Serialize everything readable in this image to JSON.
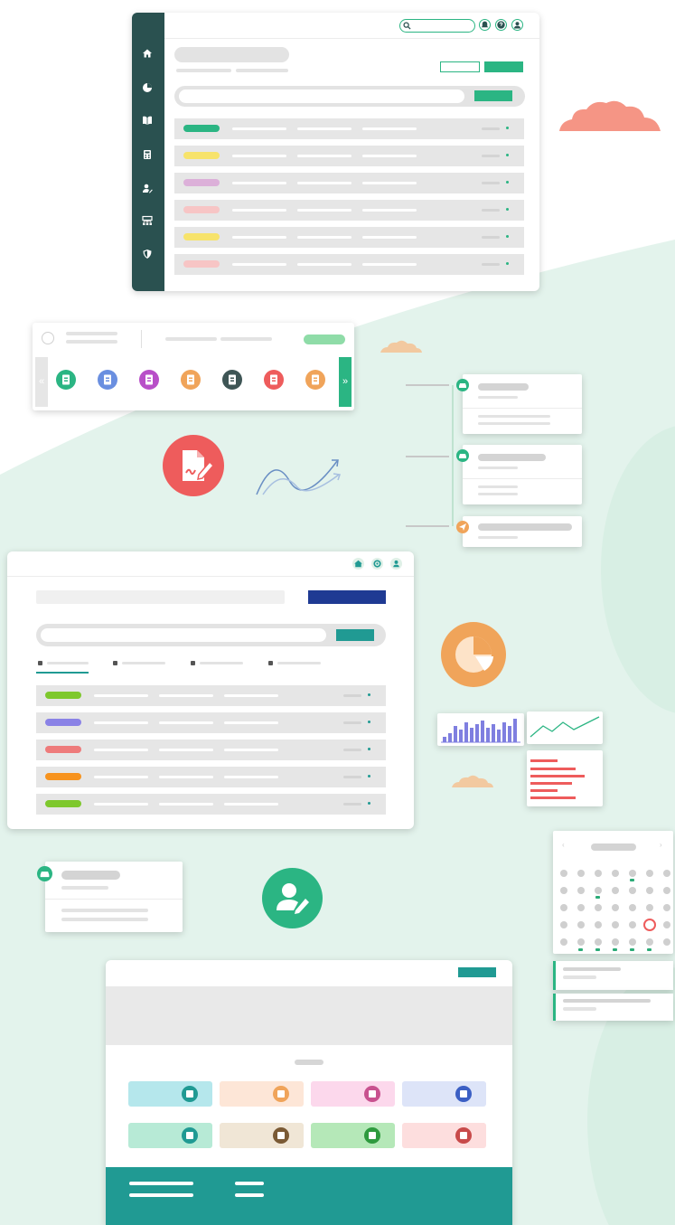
{
  "colors": {
    "brand_green": "#2bb583",
    "teal": "#209a93",
    "navy": "#1f3a93",
    "orange": "#f0a45a",
    "red": "#ee5c5c",
    "bg_mint": "#e3f3ec",
    "sidebar": "#2a5150",
    "cloud": "#f59585"
  },
  "icons": {
    "sidebar": [
      "home-icon",
      "pie-chart-icon",
      "book-icon",
      "calculator-icon",
      "user-edit-icon",
      "org-chart-icon",
      "shield-icon"
    ],
    "header_top": [
      "search-icon",
      "bell-icon",
      "help-icon",
      "user-icon"
    ],
    "header_mid": [
      "home-icon",
      "settings-icon",
      "user-icon"
    ],
    "carousel": [
      "user-check-icon",
      "document-icon",
      "document-icon",
      "user-hand-icon",
      "document-icon",
      "document-edit-icon",
      "document-icon"
    ],
    "feature": [
      "document-signature-icon",
      "user-edit-icon",
      "pie-chart-icon"
    ],
    "tiles": [
      "library-icon",
      "grid-icon",
      "building-icon",
      "person-icon",
      "monitor-icon",
      "pie-chart-icon",
      "support-icon",
      "calculator-icon"
    ]
  },
  "calendar": {
    "rows": 5,
    "cols": 7,
    "selected_row": 3,
    "selected_col": 5
  }
}
